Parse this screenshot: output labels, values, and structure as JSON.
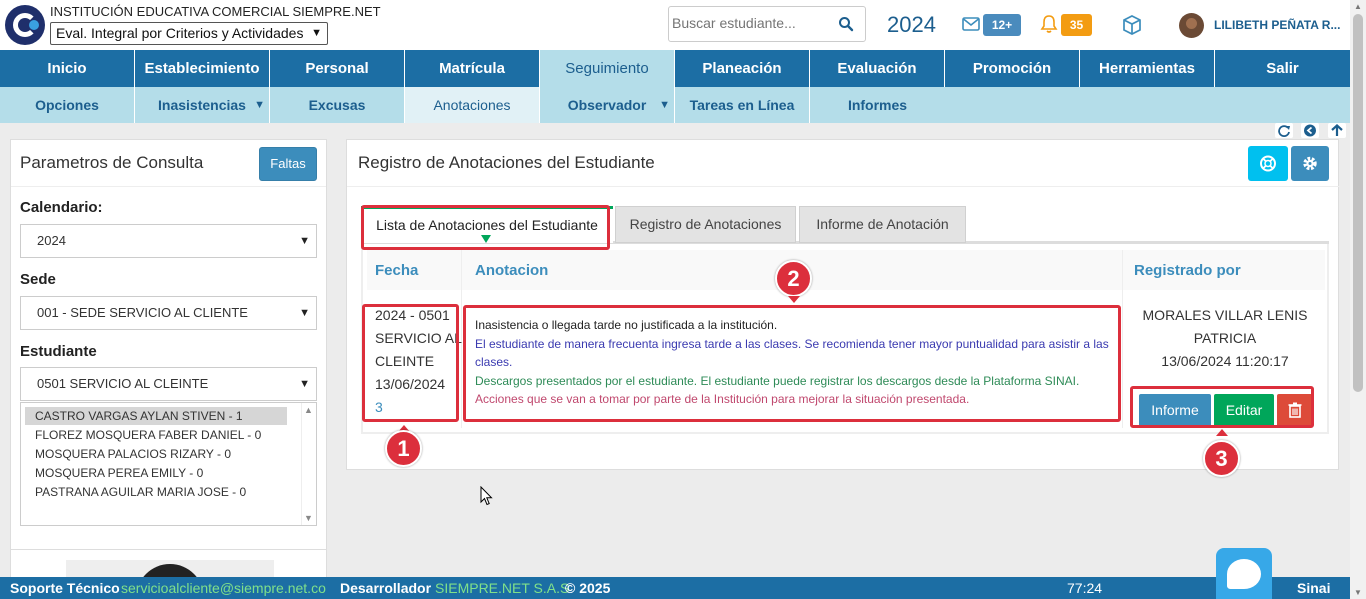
{
  "header": {
    "school_name": "INSTITUCIÓN EDUCATIVA COMERCIAL SIEMPRE.NET",
    "eval_select": "Eval. Integral por Criterios y Actividades",
    "search_placeholder": "Buscar estudiante...",
    "year": "2024",
    "mail_badge": "12+",
    "bell_badge": "35",
    "user_name": "LILIBETH PEÑATA R..."
  },
  "main_nav": [
    {
      "label": "Inicio"
    },
    {
      "label": "Establecimiento"
    },
    {
      "label": "Personal"
    },
    {
      "label": "Matrícula"
    },
    {
      "label": "Seguimiento"
    },
    {
      "label": "Planeación"
    },
    {
      "label": "Evaluación"
    },
    {
      "label": "Promoción"
    },
    {
      "label": "Herramientas"
    },
    {
      "label": "Salir"
    }
  ],
  "sub_nav": [
    {
      "label": "Opciones"
    },
    {
      "label": "Inasistencias"
    },
    {
      "label": "Excusas"
    },
    {
      "label": "Anotaciones"
    },
    {
      "label": "Observador"
    },
    {
      "label": "Tareas en Línea"
    },
    {
      "label": "Informes"
    }
  ],
  "left_panel": {
    "title": "Parametros de Consulta",
    "faltas_button": "Faltas",
    "calendario_label": "Calendario:",
    "calendario_value": "2024",
    "sede_label": "Sede",
    "sede_value": "001 - SEDE SERVICIO AL CLIENTE",
    "estudiante_label": "Estudiante",
    "estudiante_value": "0501 SERVICIO AL CLEINTE",
    "students": [
      "CASTRO VARGAS AYLAN STIVEN - 1",
      "FLOREZ MOSQUERA FABER DANIEL - 0",
      "MOSQUERA PALACIOS RIZARY - 0",
      "MOSQUERA PEREA EMILY - 0",
      "PASTRANA AGUILAR MARIA JOSE - 0"
    ]
  },
  "right_panel": {
    "title": "Registro de Anotaciones del Estudiante",
    "tabs": [
      {
        "label": "Lista de Anotaciones del Estudiante"
      },
      {
        "label": "Registro de Anotaciones"
      },
      {
        "label": "Informe de Anotación"
      }
    ],
    "columns": {
      "fecha": "Fecha",
      "anotacion": "Anotacion",
      "registrado": "Registrado por"
    },
    "row": {
      "fecha_lines": [
        "2024  - 0501",
        "SERVICIO AL",
        "CLEINTE",
        "13/06/2024"
      ],
      "fecha_number": "3",
      "anotacion_1": "Inasistencia o llegada tarde no justificada a la institución.",
      "anotacion_2": "El estudiante de manera frecuenta ingresa tarde a las clases. Se recomienda tener mayor puntualidad para asistir a las clases.",
      "anotacion_3": "Descargos presentados por el estudiante. El estudiante puede registrar los descargos desde la Plataforma SINAI.",
      "anotacion_4": "Acciones que se van a tomar por parte de la Institución para mejorar la situación presentada.",
      "registrado_name": "MORALES VILLAR LENIS PATRICIA",
      "registrado_date": "13/06/2024 11:20:17"
    },
    "buttons": {
      "informe": "Informe",
      "editar": "Editar"
    }
  },
  "annotations": {
    "marker_1": "1",
    "marker_2": "2",
    "marker_3": "3"
  },
  "footer": {
    "support_label": "Soporte Técnico",
    "support_email": "servicioalcliente@siempre.net.co",
    "dev_label": "Desarrollador",
    "dev_name": "SIEMPRE.NET S.A.S",
    "copyright": "© 2025",
    "timer": "77:24",
    "brand": "Sinai"
  },
  "colors": {
    "nav_blue": "#1c6ea4",
    "subnav_blue": "#b4dde9",
    "annotation_red": "#dc2f3c",
    "success_green": "#00a65a"
  }
}
